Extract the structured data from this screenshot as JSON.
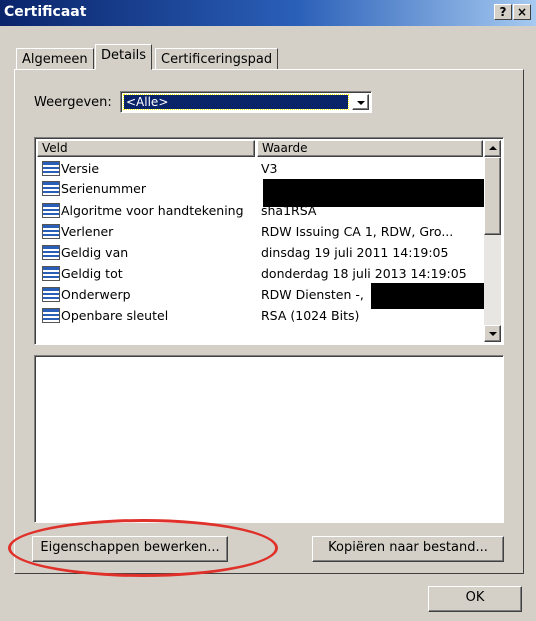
{
  "window": {
    "title": "Certificaat",
    "help_label": "?",
    "close_label": "×"
  },
  "tabs": [
    {
      "label": "Algemeen",
      "active": false
    },
    {
      "label": "Details",
      "active": true
    },
    {
      "label": "Certificeringspad",
      "active": false
    }
  ],
  "show": {
    "label": "Weergeven:",
    "selected": "<Alle>"
  },
  "list": {
    "columns": [
      "Veld",
      "Waarde"
    ],
    "rows": [
      {
        "field": "Versie",
        "value": "V3"
      },
      {
        "field": "Serienummer",
        "value": ""
      },
      {
        "field": "Algoritme voor handtekening",
        "value": "sha1RSA"
      },
      {
        "field": "Verlener",
        "value": "RDW Issuing CA 1, RDW, Gro..."
      },
      {
        "field": "Geldig van",
        "value": "dinsdag 19 juli 2011 14:19:05"
      },
      {
        "field": "Geldig tot",
        "value": "donderdag 18 juli 2013 14:19:05"
      },
      {
        "field": "Onderwerp",
        "value": "RDW Diensten -,"
      },
      {
        "field": "Openbare sleutel",
        "value": "RSA (1024 Bits)"
      }
    ]
  },
  "buttons": {
    "edit_properties": "Eigenschappen bewerken...",
    "copy_to_file": "Kopiëren naar bestand...",
    "ok": "OK"
  },
  "colors": {
    "titlebar": "#0a246a",
    "face": "#d4d0c8",
    "highlight_circle": "#e0302a"
  }
}
